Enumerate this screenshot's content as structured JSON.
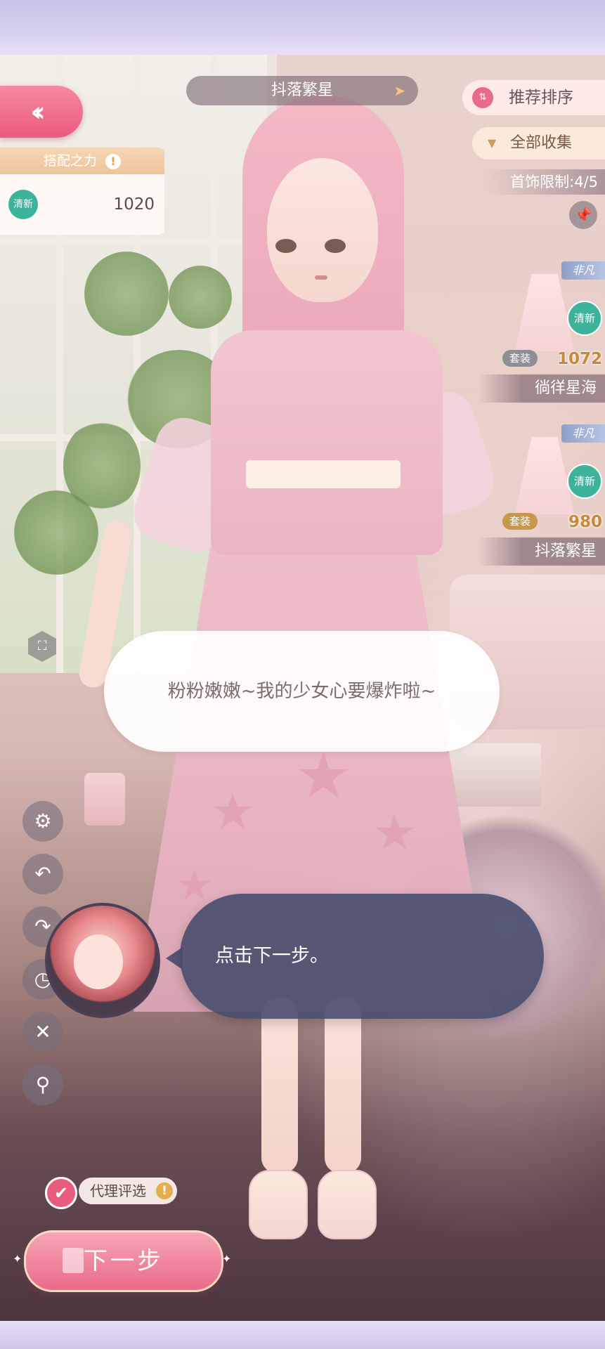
{
  "header": {
    "outfit_name": "抖落繁星",
    "sort_label": "推荐排序",
    "filter_label": "全部收集",
    "accessory_limit": "首饰限制:4/5"
  },
  "power_panel": {
    "title": "搭配之力",
    "style_badge": "清新",
    "score": "1020"
  },
  "cards": [
    {
      "tag": "非凡",
      "style": "清新",
      "set": "套装",
      "score": "1072",
      "title": "徜徉星海",
      "set_color": "#8e8e95"
    },
    {
      "tag": "非凡",
      "style": "清新",
      "set": "套装",
      "score": "980",
      "title": "抖落繁星",
      "set_color": "#c7974d"
    }
  ],
  "dialog": {
    "character_line": "粉粉嫩嫩~我的少女心要爆炸啦~",
    "guide_line": "点击下一步。"
  },
  "side_tools": [
    {
      "name": "settings",
      "icon": "gear-icon",
      "glyph": "⚙"
    },
    {
      "name": "undo",
      "icon": "undo-icon",
      "glyph": "↶"
    },
    {
      "name": "redo",
      "icon": "redo-icon",
      "glyph": "↷"
    },
    {
      "name": "history",
      "icon": "clock-icon",
      "glyph": "◷"
    },
    {
      "name": "delete",
      "icon": "trash-icon",
      "glyph": "🗑"
    },
    {
      "name": "search",
      "icon": "search-icon",
      "glyph": "⚲"
    }
  ],
  "bottom": {
    "proxy_label": "代理评选",
    "proxy_checked": true,
    "next_label": "下一步"
  },
  "colors": {
    "accent_pink": "#ea5a7e",
    "fresh_green": "#3db39c",
    "guide_bubble": "#484c6e"
  }
}
